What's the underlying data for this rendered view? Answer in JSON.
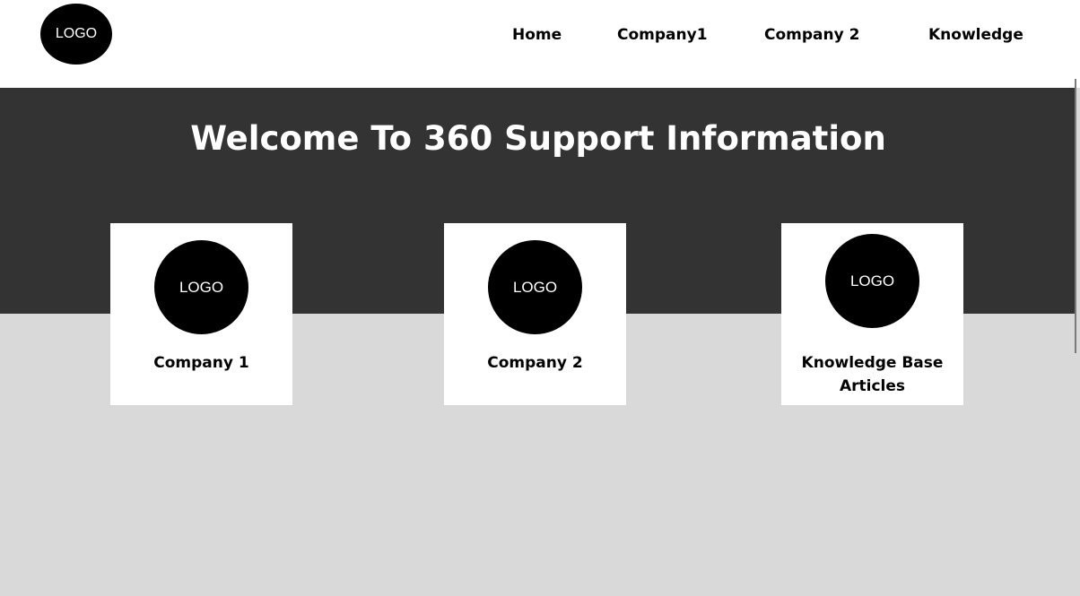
{
  "header": {
    "logo_text": "LOGO",
    "nav": {
      "home": "Home",
      "company1": "Company1",
      "company2": "Company 2",
      "knowledge": "Knowledge"
    }
  },
  "hero": {
    "title": "Welcome To 360 Support Information"
  },
  "cards": [
    {
      "logo_text": "LOGO",
      "label": "Company 1"
    },
    {
      "logo_text": "LOGO",
      "label": "Company 2"
    },
    {
      "logo_text": "LOGO",
      "label": "Knowledge Base Articles"
    }
  ],
  "colors": {
    "hero_background": "#333333",
    "page_background": "#d9d9d9",
    "logo_fill": "#000000",
    "card_background": "#ffffff"
  }
}
